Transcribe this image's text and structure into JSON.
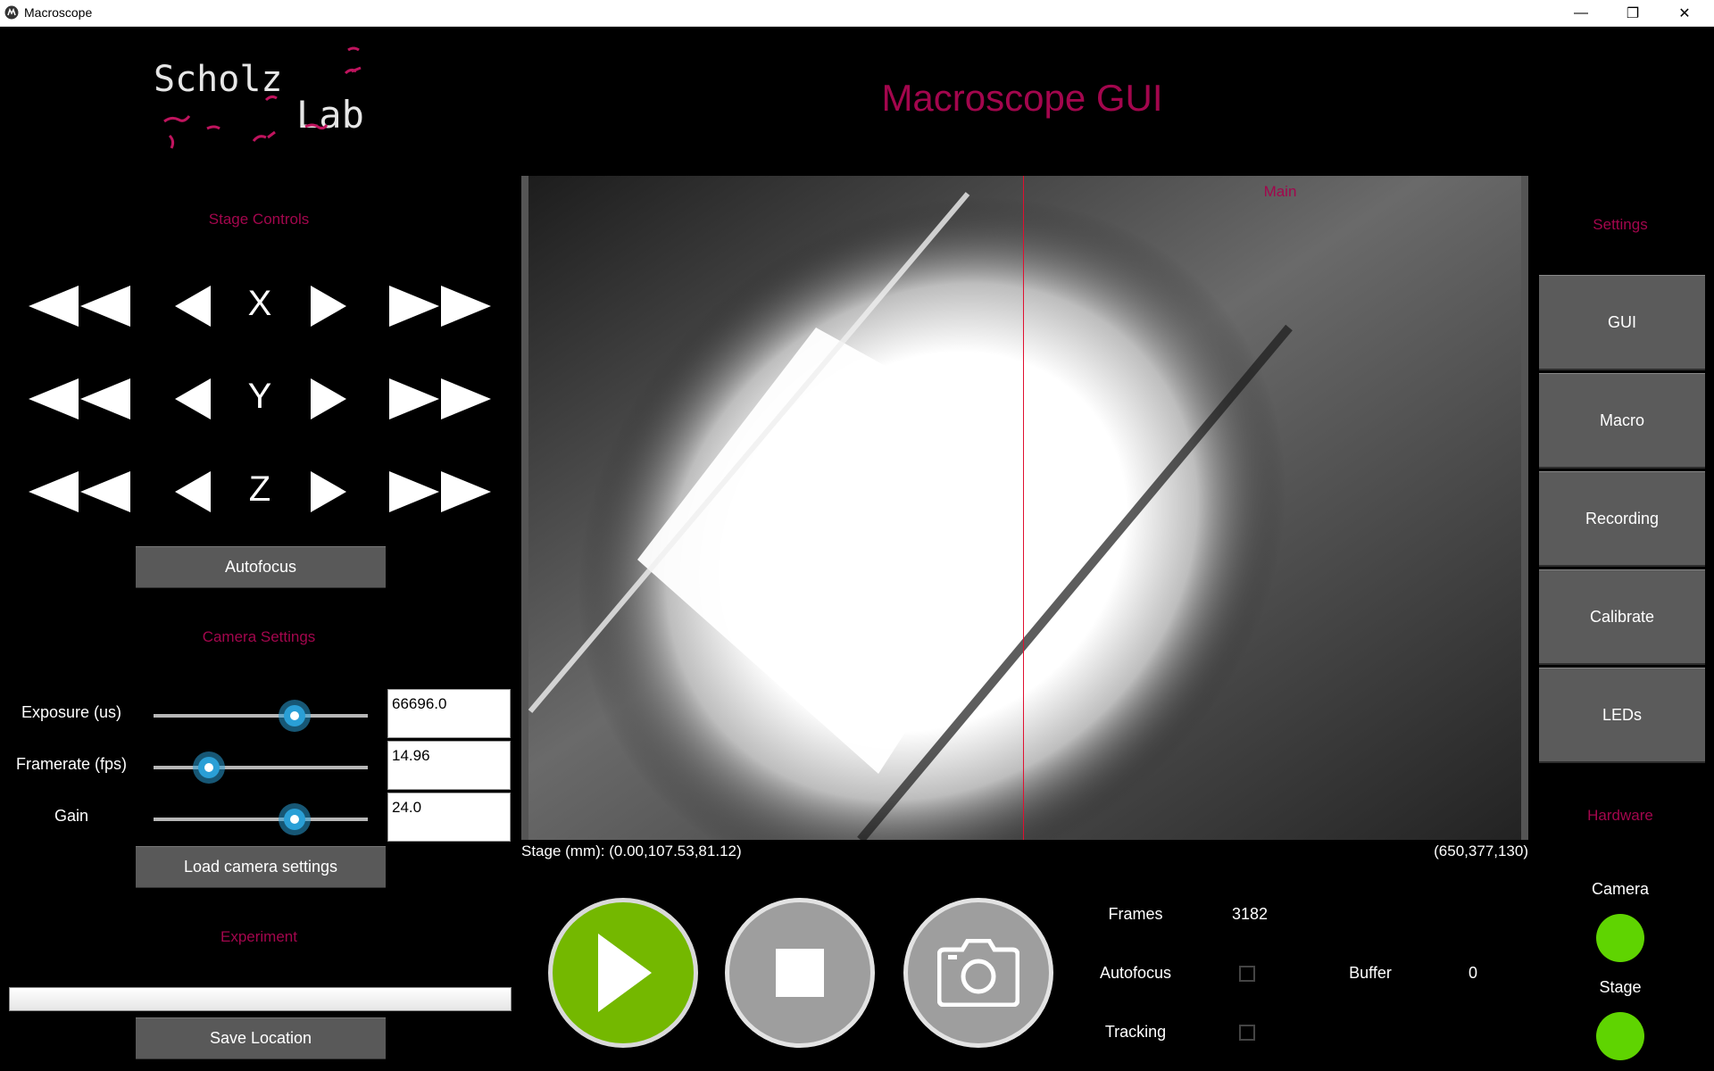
{
  "window": {
    "title": "Macroscope",
    "minimize": "—",
    "restore": "❐",
    "close": "✕"
  },
  "logo": {
    "word1": "Scholz",
    "word2": "Lab"
  },
  "app_title": "Macroscope GUI",
  "stage_controls": {
    "heading": "Stage Controls",
    "axes": [
      "X",
      "Y",
      "Z"
    ],
    "autofocus_label": "Autofocus"
  },
  "camera_settings": {
    "heading": "Camera Settings",
    "rows": [
      {
        "label": "Exposure (us)",
        "value": "66696.0",
        "position": 0.66
      },
      {
        "label": "Framerate (fps)",
        "value": "14.96",
        "position": 0.26
      },
      {
        "label": "Gain",
        "value": "24.0",
        "position": 0.66
      }
    ],
    "load_label": "Load camera settings"
  },
  "experiment": {
    "heading": "Experiment",
    "location_value": "",
    "save_label": "Save Location"
  },
  "viewer": {
    "label": "Main",
    "stage_text": "Stage (mm): (0.00,107.53,81.12)",
    "coords_text": "(650,377,130)"
  },
  "controls": {
    "play_icon": "play-icon",
    "stop_icon": "stop-icon",
    "camera_icon": "camera-icon"
  },
  "stats": {
    "frames_label": "Frames",
    "frames_value": "3182",
    "autofocus_label": "Autofocus",
    "autofocus_checked": false,
    "buffer_label": "Buffer",
    "buffer_value": "0",
    "tracking_label": "Tracking",
    "tracking_checked": false
  },
  "settings": {
    "heading": "Settings",
    "buttons": [
      "GUI",
      "Macro",
      "Recording",
      "Calibrate",
      "LEDs"
    ]
  },
  "hardware": {
    "heading": "Hardware",
    "items": [
      {
        "label": "Camera",
        "status_color": "#5fd401"
      },
      {
        "label": "Stage",
        "status_color": "#5fd401"
      }
    ]
  },
  "colors": {
    "accent": "#a3064d",
    "play_green": "#74b800",
    "button_gray": "#595959"
  }
}
